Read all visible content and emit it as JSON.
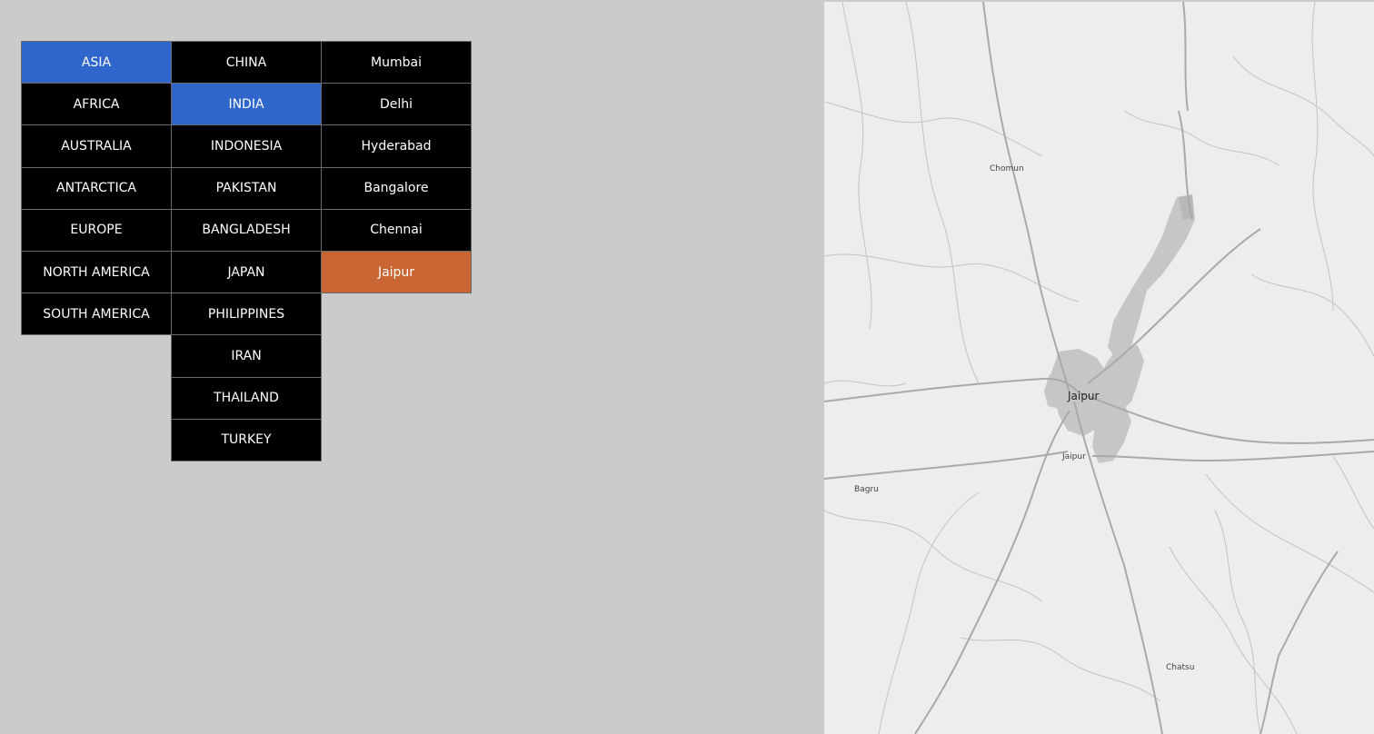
{
  "continents": {
    "items": [
      {
        "label": "ASIA",
        "selected": true
      },
      {
        "label": "AFRICA",
        "selected": false
      },
      {
        "label": "AUSTRALIA",
        "selected": false
      },
      {
        "label": "ANTARCTICA",
        "selected": false
      },
      {
        "label": "EUROPE",
        "selected": false
      },
      {
        "label": "NORTH AMERICA",
        "selected": false
      },
      {
        "label": "SOUTH AMERICA",
        "selected": false
      }
    ]
  },
  "countries": {
    "items": [
      {
        "label": "CHINA",
        "selected": false
      },
      {
        "label": "INDIA",
        "selected": true
      },
      {
        "label": "INDONESIA",
        "selected": false
      },
      {
        "label": "PAKISTAN",
        "selected": false
      },
      {
        "label": "BANGLADESH",
        "selected": false
      },
      {
        "label": "JAPAN",
        "selected": false
      },
      {
        "label": "PHILIPPINES",
        "selected": false
      },
      {
        "label": "IRAN",
        "selected": false
      },
      {
        "label": "THAILAND",
        "selected": false
      },
      {
        "label": "TURKEY",
        "selected": false
      }
    ]
  },
  "cities": {
    "items": [
      {
        "label": "Mumbai",
        "selected": false
      },
      {
        "label": "Delhi",
        "selected": false
      },
      {
        "label": "Hyderabad",
        "selected": false
      },
      {
        "label": "Bangalore",
        "selected": false
      },
      {
        "label": "Chennai",
        "selected": false
      },
      {
        "label": "Jaipur",
        "selected": true
      }
    ]
  },
  "map": {
    "labels": {
      "chomun": "Chomun",
      "jaipur": "Jaipur",
      "jaipur_small": "Jaipur",
      "bagru": "Bagru",
      "chatsu": "Chatsu"
    }
  },
  "colors": {
    "background": "#cbcbcb",
    "cell": "#000000",
    "selected_blue": "#2f66cc",
    "selected_orange": "#c86533",
    "map_land": "#ededed",
    "map_urban": "#c4c4c4",
    "map_road": "#b5b5b5"
  }
}
